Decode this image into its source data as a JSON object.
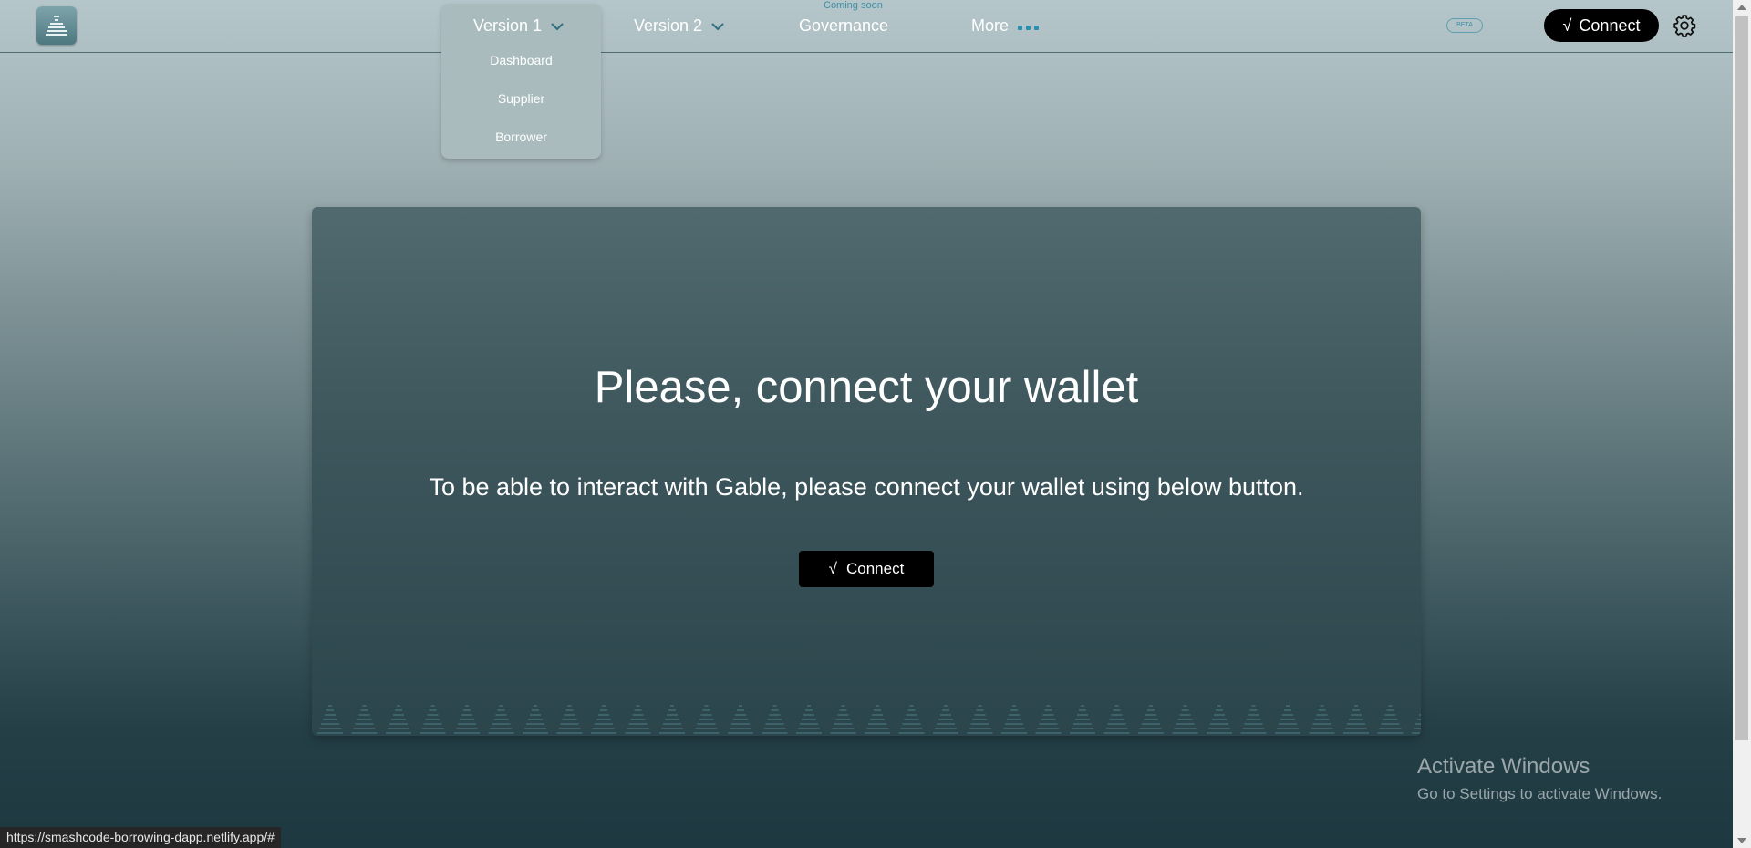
{
  "nav": {
    "version1": {
      "label": "Version 1",
      "items": [
        "Dashboard",
        "Supplier",
        "Borrower"
      ]
    },
    "version2": {
      "label": "Version 2"
    },
    "governance": {
      "label": "Governance",
      "badge": "Coming soon"
    },
    "more": {
      "label": "More"
    },
    "beta_badge": "BETA",
    "connect_label": "Connect",
    "connect_glyph": "√"
  },
  "main": {
    "title": "Please, connect your wallet",
    "subtitle": "To be able to interact with Gable, please connect your wallet using below button.",
    "connect_label": "Connect",
    "connect_glyph": "√"
  },
  "status_url": "https://smashcode-borrowing-dapp.netlify.app/#",
  "watermark": {
    "title": "Activate Windows",
    "subtitle": "Go to Settings to activate Windows."
  },
  "colors": {
    "accent": "#2b8fb0",
    "button_bg": "#000000",
    "card_top": "#516a70",
    "card_bottom": "#2b454c"
  },
  "icons": [
    "logo-icon",
    "chevron-down-icon",
    "more-dots-icon",
    "gear-icon"
  ]
}
